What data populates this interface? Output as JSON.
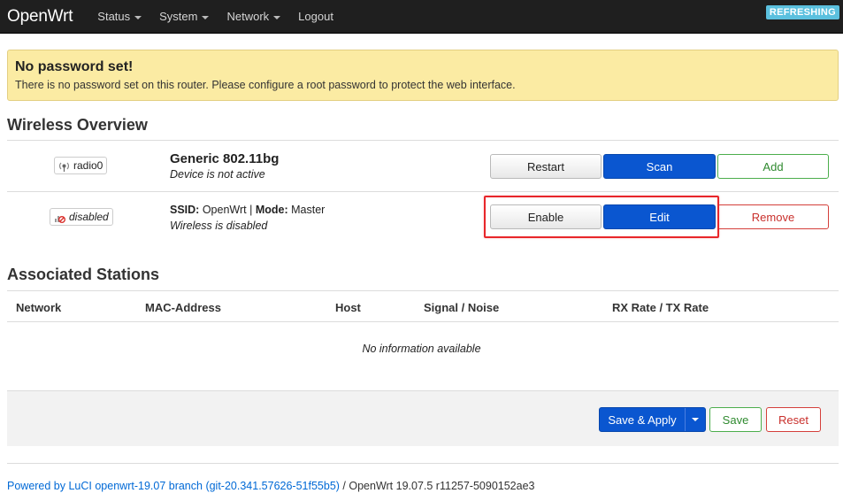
{
  "topbar": {
    "brand": "OpenWrt",
    "menu": [
      {
        "label": "Status",
        "has_caret": true
      },
      {
        "label": "System",
        "has_caret": true
      },
      {
        "label": "Network",
        "has_caret": true
      },
      {
        "label": "Logout",
        "has_caret": false
      }
    ],
    "status_badge": "REFRESHING"
  },
  "alert": {
    "title": "No password set!",
    "text": "There is no password set on this router. Please configure a root password to protect the web interface."
  },
  "wireless": {
    "title": "Wireless Overview",
    "device": {
      "badge": "radio0",
      "name": "Generic 802.11bg",
      "status": "Device is not active",
      "buttons": {
        "restart": "Restart",
        "scan": "Scan",
        "add": "Add"
      }
    },
    "network": {
      "badge": "disabled",
      "ssid_label": "SSID:",
      "ssid_value": "OpenWrt",
      "separator": "|",
      "mode_label": "Mode:",
      "mode_value": "Master",
      "status": "Wireless is disabled",
      "buttons": {
        "enable": "Enable",
        "edit": "Edit",
        "remove": "Remove"
      }
    }
  },
  "stations": {
    "title": "Associated Stations",
    "columns": [
      "Network",
      "MAC-Address",
      "Host",
      "Signal / Noise",
      "RX Rate / TX Rate"
    ],
    "empty": "No information available"
  },
  "actions": {
    "save_apply": "Save & Apply",
    "save": "Save",
    "reset": "Reset"
  },
  "footer": {
    "link": "Powered by LuCI openwrt-19.07 branch (git-20.341.57626-51f55b5)",
    "version": " / OpenWrt 19.07.5 r11257-5090152ae3"
  },
  "colors": {
    "topbar": "#1f1f1f",
    "primary": "#0a56d0",
    "alert_bg": "#fbeba3",
    "highlight": "#e8262a",
    "refreshing": "#5bc0de"
  }
}
